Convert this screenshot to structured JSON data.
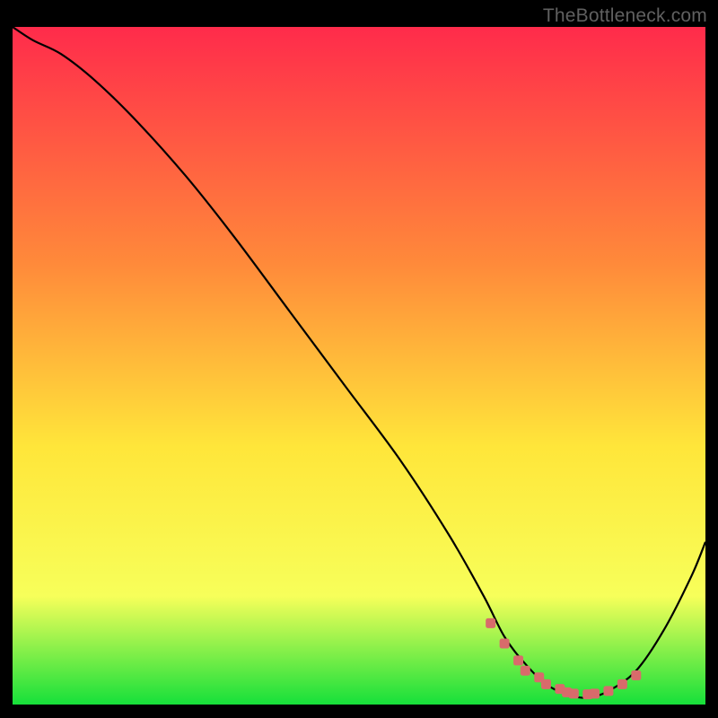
{
  "attribution": "TheBottleneck.com",
  "colors": {
    "gradient_top": "#ff2b4b",
    "gradient_mid1": "#ff8a3a",
    "gradient_mid2": "#ffe63a",
    "gradient_mid3": "#f7ff5a",
    "gradient_bottom": "#16e03a",
    "curve": "#000000",
    "markers": "#d86b6b",
    "frame": "#000000",
    "page_bg": "#000000"
  },
  "chart_data": {
    "type": "line",
    "title": "",
    "xlabel": "",
    "ylabel": "",
    "xlim": [
      0,
      100
    ],
    "ylim": [
      0,
      100
    ],
    "series": [
      {
        "name": "curve",
        "x": [
          0,
          3,
          7,
          12,
          18,
          25,
          32,
          40,
          48,
          56,
          63,
          68,
          71,
          74,
          77,
          80,
          83,
          86,
          90,
          94,
          98,
          100
        ],
        "y": [
          100,
          98,
          96,
          92,
          86,
          78,
          69,
          58,
          47,
          36,
          25,
          16,
          10,
          6,
          3,
          1.5,
          1,
          2,
          5,
          11,
          19,
          24
        ]
      }
    ],
    "markers": {
      "name": "highlight-points",
      "color": "#d86b6b",
      "x": [
        69,
        71,
        73,
        74,
        76,
        77,
        79,
        80,
        81,
        83,
        84,
        86,
        88,
        90
      ],
      "y": [
        12,
        9,
        6.5,
        5,
        4,
        3,
        2.3,
        1.8,
        1.6,
        1.5,
        1.6,
        2,
        3,
        4.3
      ]
    }
  }
}
